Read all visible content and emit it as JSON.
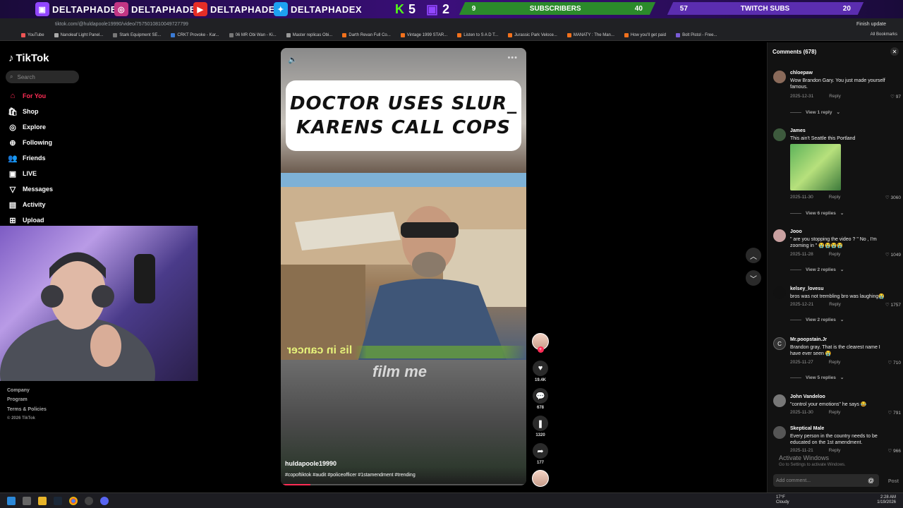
{
  "banner": {
    "handles": [
      "DELTAPHADE",
      "DELTAPHADE",
      "DELTAPHADE",
      "DELTAPHADEX"
    ],
    "kick_count": "5",
    "twitch_count": "2",
    "subscribers": {
      "current": "9",
      "label": "SUBSCRIBERS",
      "goal": "40"
    },
    "twitch_subs": {
      "current": "57",
      "label": "TWITCH SUBS",
      "goal": "20"
    }
  },
  "browser": {
    "url": "tiktok.com/@huldapoole19990/video/7575010810049727799",
    "bookmarks": [
      "YouTube",
      "Nanoleaf Light Panel...",
      "Stark Equipment SE...",
      "CRKT Provoke - Kar...",
      "06 MR Obi Wan - Ki...",
      "Master replicas Obi...",
      "Darth Revan Full Co...",
      "Vintage 1999 STAR...",
      "Listen to S A D T...",
      "Jurassic Park Veloce...",
      "MANATY : The Man...",
      "How you'll get paid",
      "Bolt Pistol - Free..."
    ],
    "all_bookmarks": "All Bookmarks",
    "finish_update": "Finish update"
  },
  "sidebar": {
    "logo": "TikTok",
    "search_placeholder": "Search",
    "items": [
      {
        "label": "For You",
        "icon": "home-icon"
      },
      {
        "label": "Shop",
        "icon": "shop-icon"
      },
      {
        "label": "Explore",
        "icon": "compass-icon"
      },
      {
        "label": "Following",
        "icon": "following-icon"
      },
      {
        "label": "Friends",
        "icon": "friends-icon"
      },
      {
        "label": "LIVE",
        "icon": "live-icon"
      },
      {
        "label": "Messages",
        "icon": "messages-icon"
      },
      {
        "label": "Activity",
        "icon": "activity-icon"
      },
      {
        "label": "Upload",
        "icon": "upload-icon"
      }
    ],
    "footer": [
      "Company",
      "Program",
      "Terms & Policies",
      "© 2026 TikTok"
    ]
  },
  "video": {
    "caption_line1": "DOCTOR USES SLUR_",
    "caption_line2": "KARENS CALL COPS",
    "subtitle_mirrored": "lis in cancer",
    "overlay_text": "film me",
    "author": "huldapoole19990",
    "hashtags": "#copoftiktok #audit #policeofficer #1stamendment #trending",
    "progress_fraction": 0.12
  },
  "actions": {
    "likes": "19.4K",
    "comments": "678",
    "saves": "1320",
    "shares": "177"
  },
  "comments": {
    "header": "Comments (678)",
    "input_placeholder": "Add comment...",
    "post_label": "Post",
    "items": [
      {
        "user": "chloepaw",
        "text": "Wow Brandon Gary. You just made yourself famous.",
        "date": "2025-12-31",
        "reply": "Reply",
        "likes": "97",
        "replies": "View 1 reply"
      },
      {
        "user": "James",
        "text": "This ain't Seattle this Portland",
        "date": "2025-11-30",
        "reply": "Reply",
        "likes": "3060",
        "replies": "View 6 replies"
      },
      {
        "user": "Jooo",
        "text": "\" are you stopping the video ? \" No , I'm zooming in \" 😭😭😭😭",
        "date": "2025-11-28",
        "reply": "Reply",
        "likes": "1049",
        "replies": "View 2 replies"
      },
      {
        "user": "kelsey_lovesu",
        "text": "bros was not trembling bro was laughing😭",
        "date": "2025-12-21",
        "reply": "Reply",
        "likes": "1757",
        "replies": "View 2 replies"
      },
      {
        "user": "Mr.poopstain.Jr",
        "text": "Brandon gray. That is the clearest name I have ever seen 😭",
        "date": "2025-11-27",
        "reply": "Reply",
        "likes": "710",
        "replies": "View 5 replies"
      },
      {
        "user": "John Vandeloo",
        "text": "\"control your emotions\" he says 😂",
        "date": "2025-11-30",
        "reply": "Reply",
        "likes": "791"
      },
      {
        "user": "Skeptical Male",
        "text": "Every person in the country needs to be educated on the 1st amendment.",
        "date": "2025-11-21",
        "reply": "Reply",
        "likes": "966"
      }
    ],
    "avatar_letter_c": "C"
  },
  "windows": {
    "activate_title": "Activate Windows",
    "activate_sub": "Go to Settings to activate Windows."
  },
  "taskbar": {
    "weather_temp": "17°F",
    "weather_desc": "Cloudy",
    "time": "2:28 AM",
    "date": "1/19/2026"
  }
}
